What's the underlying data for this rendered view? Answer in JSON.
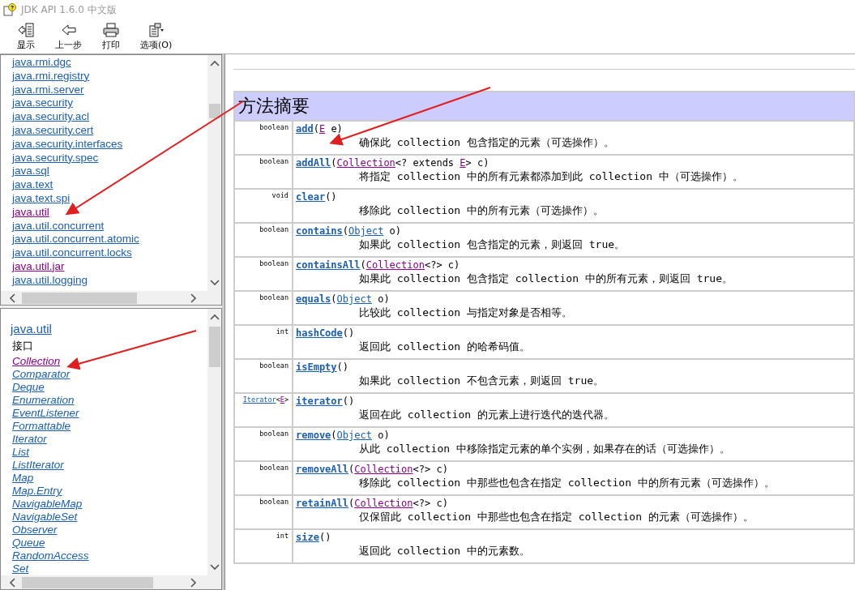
{
  "window": {
    "title": "JDK API 1.6.0 中文版"
  },
  "toolbar": [
    {
      "label": "显示",
      "kind": "show"
    },
    {
      "label": "上一步",
      "kind": "back"
    },
    {
      "label": "打印",
      "kind": "print"
    },
    {
      "label": "选项(O)",
      "kind": "options"
    }
  ],
  "packages": [
    {
      "label": "java.rmi.dgc",
      "visited": false
    },
    {
      "label": "java.rmi.registry",
      "visited": false
    },
    {
      "label": "java.rmi.server",
      "visited": false
    },
    {
      "label": "java.security",
      "visited": false
    },
    {
      "label": "java.security.acl",
      "visited": false
    },
    {
      "label": "java.security.cert",
      "visited": false
    },
    {
      "label": "java.security.interfaces",
      "visited": false
    },
    {
      "label": "java.security.spec",
      "visited": false
    },
    {
      "label": "java.sql",
      "visited": false
    },
    {
      "label": "java.text",
      "visited": false
    },
    {
      "label": "java.text.spi",
      "visited": false
    },
    {
      "label": "java.util",
      "visited": true
    },
    {
      "label": "java.util.concurrent",
      "visited": false
    },
    {
      "label": "java.util.concurrent.atomic",
      "visited": false
    },
    {
      "label": "java.util.concurrent.locks",
      "visited": false
    },
    {
      "label": "java.util.jar",
      "visited": true
    },
    {
      "label": "java.util.logging",
      "visited": false
    }
  ],
  "package_panel": {
    "title": "java.util",
    "section": "接口",
    "classes": [
      {
        "label": "Collection",
        "visited": true
      },
      {
        "label": "Comparator",
        "visited": false
      },
      {
        "label": "Deque",
        "visited": false
      },
      {
        "label": "Enumeration",
        "visited": false
      },
      {
        "label": "EventListener",
        "visited": false
      },
      {
        "label": "Formattable",
        "visited": false
      },
      {
        "label": "Iterator",
        "visited": false
      },
      {
        "label": "List",
        "visited": false
      },
      {
        "label": "ListIterator",
        "visited": false
      },
      {
        "label": "Map",
        "visited": false
      },
      {
        "label": "Map.Entry",
        "visited": false
      },
      {
        "label": "NavigableMap",
        "visited": false
      },
      {
        "label": "NavigableSet",
        "visited": false
      },
      {
        "label": "Observer",
        "visited": false
      },
      {
        "label": "Queue",
        "visited": false
      },
      {
        "label": "RandomAccess",
        "visited": false
      },
      {
        "label": "Set",
        "visited": false
      }
    ]
  },
  "method_summary": {
    "title": "方法摘要",
    "methods": [
      {
        "returns": [
          {
            "text": "boolean",
            "kind": "plain"
          }
        ],
        "name": "add",
        "params": [
          {
            "text": "(",
            "kind": "plain"
          },
          {
            "text": "E",
            "kind": "link",
            "visited": true
          },
          {
            "text": " e)",
            "kind": "plain"
          }
        ],
        "description": "确保此 collection 包含指定的元素（可选操作）。"
      },
      {
        "returns": [
          {
            "text": "boolean",
            "kind": "plain"
          }
        ],
        "name": "addAll",
        "params": [
          {
            "text": "(",
            "kind": "plain"
          },
          {
            "text": "Collection",
            "kind": "link",
            "visited": true
          },
          {
            "text": "<? extends ",
            "kind": "plain"
          },
          {
            "text": "E",
            "kind": "link",
            "visited": true
          },
          {
            "text": "> c)",
            "kind": "plain"
          }
        ],
        "description": "将指定 collection 中的所有元素都添加到此 collection 中（可选操作）。"
      },
      {
        "returns": [
          {
            "text": "void",
            "kind": "plain"
          }
        ],
        "name": "clear",
        "params": [
          {
            "text": "()",
            "kind": "plain"
          }
        ],
        "description": "移除此 collection 中的所有元素（可选操作）。"
      },
      {
        "returns": [
          {
            "text": "boolean",
            "kind": "plain"
          }
        ],
        "name": "contains",
        "params": [
          {
            "text": "(",
            "kind": "plain"
          },
          {
            "text": "Object",
            "kind": "link",
            "visited": false
          },
          {
            "text": " o)",
            "kind": "plain"
          }
        ],
        "description": "如果此 collection 包含指定的元素，则返回 true。"
      },
      {
        "returns": [
          {
            "text": "boolean",
            "kind": "plain"
          }
        ],
        "name": "containsAll",
        "params": [
          {
            "text": "(",
            "kind": "plain"
          },
          {
            "text": "Collection",
            "kind": "link",
            "visited": true
          },
          {
            "text": "<?> c)",
            "kind": "plain"
          }
        ],
        "description": "如果此 collection 包含指定 collection 中的所有元素，则返回 true。"
      },
      {
        "returns": [
          {
            "text": "boolean",
            "kind": "plain"
          }
        ],
        "name": "equals",
        "params": [
          {
            "text": "(",
            "kind": "plain"
          },
          {
            "text": "Object",
            "kind": "link",
            "visited": false
          },
          {
            "text": " o)",
            "kind": "plain"
          }
        ],
        "description": "比较此 collection 与指定对象是否相等。"
      },
      {
        "returns": [
          {
            "text": "int",
            "kind": "plain"
          }
        ],
        "name": "hashCode",
        "params": [
          {
            "text": "()",
            "kind": "plain"
          }
        ],
        "description": "返回此 collection 的哈希码值。"
      },
      {
        "returns": [
          {
            "text": "boolean",
            "kind": "plain"
          }
        ],
        "name": "isEmpty",
        "params": [
          {
            "text": "()",
            "kind": "plain"
          }
        ],
        "description": "如果此 collection 不包含元素，则返回 true。"
      },
      {
        "returns": [
          {
            "text": "Iterator",
            "kind": "link",
            "visited": false
          },
          {
            "text": "<",
            "kind": "plain"
          },
          {
            "text": "E",
            "kind": "link",
            "visited": true
          },
          {
            "text": ">",
            "kind": "plain"
          }
        ],
        "name": "iterator",
        "params": [
          {
            "text": "()",
            "kind": "plain"
          }
        ],
        "description": "返回在此 collection 的元素上进行迭代的迭代器。"
      },
      {
        "returns": [
          {
            "text": "boolean",
            "kind": "plain"
          }
        ],
        "name": "remove",
        "params": [
          {
            "text": "(",
            "kind": "plain"
          },
          {
            "text": "Object",
            "kind": "link",
            "visited": false
          },
          {
            "text": " o)",
            "kind": "plain"
          }
        ],
        "description": "从此 collection 中移除指定元素的单个实例，如果存在的话（可选操作）。"
      },
      {
        "returns": [
          {
            "text": "boolean",
            "kind": "plain"
          }
        ],
        "name": "removeAll",
        "params": [
          {
            "text": "(",
            "kind": "plain"
          },
          {
            "text": "Collection",
            "kind": "link",
            "visited": true
          },
          {
            "text": "<?> c)",
            "kind": "plain"
          }
        ],
        "description": "移除此 collection 中那些也包含在指定 collection 中的所有元素（可选操作）。"
      },
      {
        "returns": [
          {
            "text": "boolean",
            "kind": "plain"
          }
        ],
        "name": "retainAll",
        "params": [
          {
            "text": "(",
            "kind": "plain"
          },
          {
            "text": "Collection",
            "kind": "link",
            "visited": true
          },
          {
            "text": "<?> c)",
            "kind": "plain"
          }
        ],
        "description": "仅保留此 collection 中那些也包含在指定 collection 的元素（可选操作）。"
      },
      {
        "returns": [
          {
            "text": "int",
            "kind": "plain"
          }
        ],
        "name": "size",
        "params": [
          {
            "text": "()",
            "kind": "plain"
          }
        ],
        "description": "返回此 collection 中的元素数。"
      }
    ]
  }
}
